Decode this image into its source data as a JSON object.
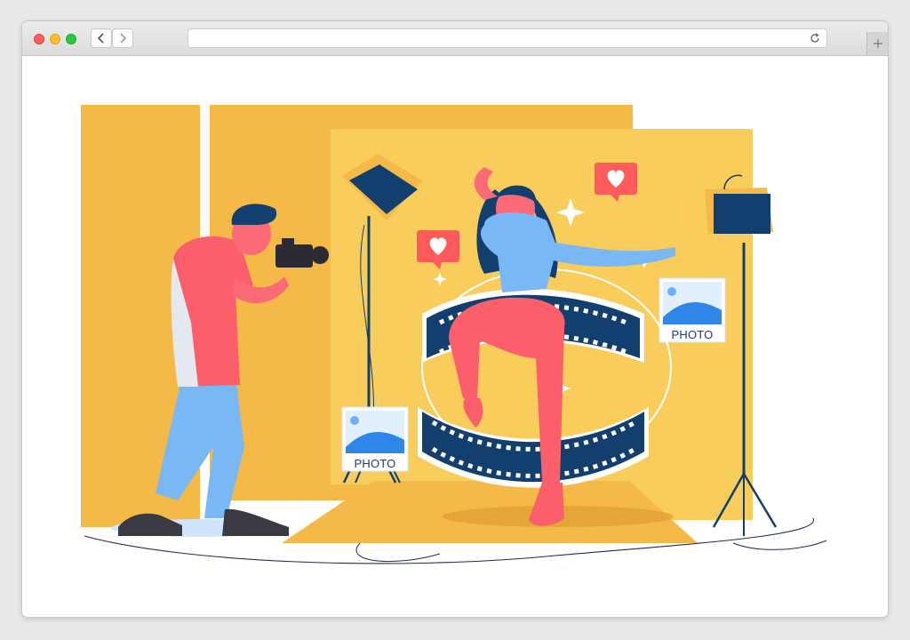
{
  "browser": {
    "url": "",
    "icons": {
      "back": "chevron-left-icon",
      "forward": "chevron-right-icon",
      "reload": "reload-icon",
      "new_tab": "plus-icon"
    }
  },
  "illustration": {
    "photo_card_left": "PHOTO",
    "photo_card_right": "PHOTO"
  },
  "colors": {
    "backdrop_orange": "#f5b947",
    "backdrop_yellow": "#f9cd5c",
    "navy": "#123f6e",
    "shirt_red": "#fa5f6b",
    "jeans_blue": "#7ab8f5",
    "heart_red": "#ff5b5b"
  }
}
